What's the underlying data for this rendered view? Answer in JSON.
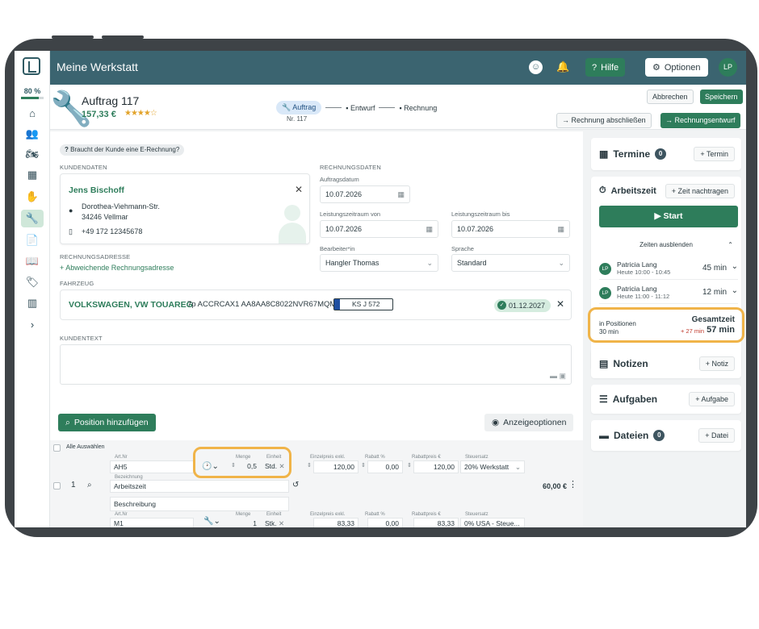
{
  "app": {
    "title": "Meine Werkstatt"
  },
  "progress": {
    "label": "80 %",
    "value": 0.8
  },
  "topbar": {
    "help_label": "Hilfe",
    "options_label": "Optionen",
    "avatar_initials": "LP"
  },
  "order": {
    "title": "Auftrag 117",
    "price": "157,33 €",
    "rating": 4,
    "steps": [
      {
        "label": "Auftrag"
      },
      {
        "label": "Entwurf"
      },
      {
        "label": "Rechnung"
      }
    ],
    "order_nr": "Nr. 117",
    "cancel_label": "Abbrechen",
    "save_label": "Speichern",
    "finish_invoice_label": "Rechnung abschließen",
    "invoice_draft_label": "Rechnungsentwurf"
  },
  "main": {
    "erechnung_label": "Braucht der Kunde eine E-Rechnung?",
    "kundendaten_label": "KUNDENDATEN",
    "rechnungsdaten_label": "RECHNUNGSDATEN",
    "customer": {
      "name": "Jens Bischoff",
      "street": "Dorothea-Viehmann-Str.",
      "city": "34246 Vellmar",
      "phone": "+49 172 12345678"
    },
    "auftragsdatum_label": "Auftragsdatum",
    "auftragsdatum": "10.07.2026",
    "leistung_von_label": "Leistungszeitraum von",
    "leistung_von": "10.07.2026",
    "leistung_bis_label": "Leistungszeitraum bis",
    "leistung_bis": "10.07.2026",
    "bearbeiter_label": "Bearbeiter*in",
    "bearbeiter": "Hangler Thomas",
    "sprache_label": "Sprache",
    "sprache": "Standard",
    "rechnungsadresse_label": "RECHNUNGSADRESSE",
    "abweichende_label": "Abweichende Rechnungsadresse",
    "fahrzeug_label": "FAHRZEUG",
    "vehicle": {
      "name": "VOLKSWAGEN, VW TOUAREG",
      "vin": "7p ACCRCAX1 AA8AA8C8022NVR67MQM",
      "plate": "KS J 572",
      "tuv_date": "01.12.2027"
    },
    "kundentext_label": "KUNDENTEXT",
    "add_position_label": "Position hinzufügen",
    "display_options_label": "Anzeigeoptionen",
    "select_all_label": "Alle Auswählen"
  },
  "columns": {
    "artnr": "Art.Nr",
    "menge": "Menge",
    "einheit": "Einheit",
    "einzelpreis": "Einzelpreis exkl.",
    "rabatt": "Rabatt %",
    "rabattpreis": "Rabattpreis €",
    "steuersatz": "Steuersatz",
    "bezeichnung": "Bezeichnung"
  },
  "positions": [
    {
      "index": "1",
      "artnr": "AH5",
      "menge": "0,5",
      "einheit": "Std.",
      "einzelpreis": "120,00",
      "rabatt": "0,00",
      "rabattpreis": "120,00",
      "steuersatz": "20% Werkstatt",
      "bezeichnung": "Arbeitszeit",
      "beschreibung": "Beschreibung",
      "total": "60,00 €"
    },
    {
      "artnr": "M1",
      "menge": "1",
      "einheit": "Stk.",
      "einzelpreis": "83,33",
      "rabatt": "0,00",
      "rabattpreis": "83,33",
      "steuersatz": "0% USA - Steue..."
    }
  ],
  "sidebar_right": {
    "termine": {
      "title": "Termine",
      "count": "0",
      "button": "Termin"
    },
    "arbeitszeit": {
      "title": "Arbeitszeit",
      "nachtragen_label": "Zeit nachtragen",
      "start_label": "Start",
      "hide_label": "Zeiten ausblenden",
      "entries": [
        {
          "initials": "LP",
          "name": "Patricia Lang",
          "time": "Heute 10:00 - 10:45",
          "duration": "45 min"
        },
        {
          "initials": "LP",
          "name": "Patricia Lang",
          "time": "Heute 11:00 - 11:12",
          "duration": "12 min"
        }
      ],
      "in_positionen_label": "in Positionen",
      "in_positionen_value": "30 min",
      "gesamtzeit_label": "Gesamtzeit",
      "gesamtzeit_diff": "+ 27 min",
      "gesamtzeit_value": "57 min"
    },
    "notizen": {
      "title": "Notizen",
      "button": "Notiz"
    },
    "aufgaben": {
      "title": "Aufgaben",
      "button": "Aufgabe"
    },
    "dateien": {
      "title": "Dateien",
      "count": "0",
      "button": "Datei"
    }
  },
  "colors": {
    "primary": "#2e7d5b",
    "header": "#3b6470",
    "highlight": "#f0b449"
  },
  "icons": [
    "logo-icon",
    "home-icon",
    "users-icon",
    "motorcycle-icon",
    "calendar-icon",
    "hand-icon",
    "wrench-icon",
    "document-icon",
    "book-icon",
    "tags-icon",
    "chart-icon",
    "chevron-right-icon",
    "smiley-icon",
    "bell-icon",
    "help-icon",
    "gear-icon"
  ]
}
